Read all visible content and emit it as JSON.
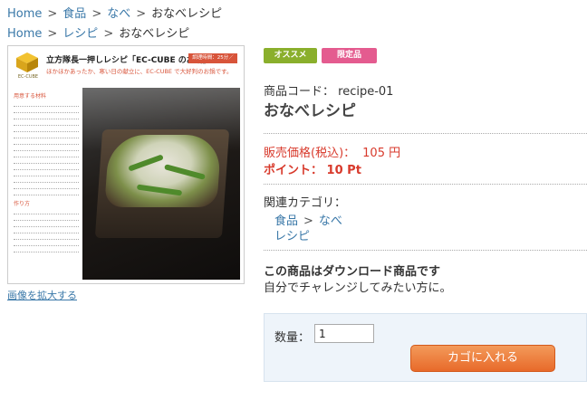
{
  "breadcrumb1": {
    "home": "Home",
    "cat1": "食品",
    "cat2": "なべ",
    "current": "おなべレシピ",
    "sep": ">"
  },
  "breadcrumb2": {
    "home": "Home",
    "cat1": "レシピ",
    "current": "おなべレシピ",
    "sep": ">"
  },
  "image": {
    "card_title": "立方隊長一押しレシピ「EC-CUBE のお鍋」",
    "card_tag": "調理時間：25分／350kcal",
    "card_sub": "ほかほかあったか、寒い日の献立に、EC-CUBE で大好判のお鍋です。",
    "logo_text": "EC-CUBE",
    "section_materials": "用意する材料",
    "section_steps": "作り方",
    "zoom_link": "画像を拡大する"
  },
  "badges": {
    "recommend": "オススメ",
    "limited": "限定品"
  },
  "product": {
    "code_label": "商品コード：",
    "code": "recipe-01",
    "name": "おなべレシピ",
    "price_label": "販売価格(税込)：",
    "price": "105 円",
    "point_label": "ポイント：",
    "point": "10 Pt",
    "category_label": "関連カテゴリ：",
    "categories": [
      {
        "path1": "食品",
        "sep": ">",
        "path2": "なべ"
      },
      {
        "path1": "レシピ"
      }
    ],
    "download_title": "この商品はダウンロード商品です",
    "description": "自分でチャレンジしてみたい方に。"
  },
  "cart": {
    "qty_label": "数量：",
    "qty_value": "1",
    "button": "カゴに入れる"
  },
  "colors": {
    "link": "#3a78a8",
    "price": "#d83a2c",
    "badge_recommend": "#8aaf2c",
    "badge_limited": "#e45b8f",
    "cart_button": "#e86a2a"
  }
}
